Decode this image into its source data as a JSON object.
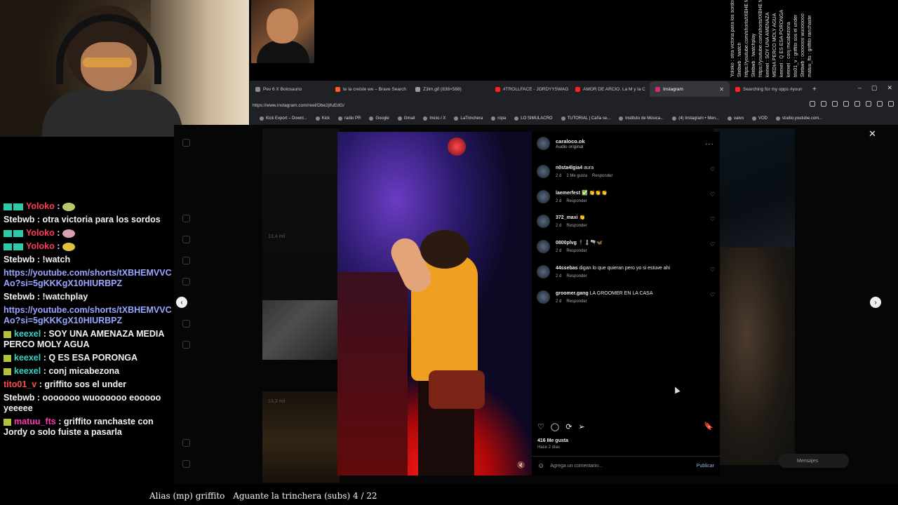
{
  "browser": {
    "tabs": [
      {
        "label": "Pev 6 X Bolosaurio",
        "color": "#8a8a8a",
        "active": false
      },
      {
        "label": "te la creiste we – Brave Search",
        "color": "#ff5a2a",
        "active": false
      },
      {
        "label": "Z3im.gif (838×588)",
        "color": "#9a9a9a",
        "active": false
      },
      {
        "label": "#TROLLFACE - JORDYYSWAG",
        "color": "#ff2020",
        "active": false
      },
      {
        "label": "AMOR DE ARCIO. La M y la C",
        "color": "#ff2020",
        "active": false
      },
      {
        "label": "Instagram",
        "color": "#d62976",
        "active": true
      },
      {
        "label": "Searching for my opps #youn",
        "color": "#ff2020",
        "active": false
      }
    ],
    "new_tab": "+",
    "url": "https://www.instagram.com/reel/Dbe2jifuEdG/",
    "bookmarks": [
      "Kick Export – Downl...",
      "Kick",
      "radio PR",
      "Google",
      "Gmail",
      "Inicio / X",
      "LaTrinchera",
      "ropa",
      "LO SIMULACRO",
      "TUTORIAL | Caña se...",
      "Instituto de Música...",
      "(4) Instagram • Men...",
      "vaivo",
      "VOD",
      "studio.youtube.com..."
    ]
  },
  "instagram": {
    "views": [
      "13,4 mil",
      "13,3 mil"
    ],
    "post": {
      "username": "caraloco.ok",
      "audio": "Audio original",
      "more": "···",
      "comments": [
        {
          "user": "n0sta4lgia4",
          "text": "aura",
          "time": "2 d",
          "likes": "2 Me gusta",
          "reply": "Responder"
        },
        {
          "user": "laemerfest",
          "text": "✅ 👏👏👏",
          "time": "2 d",
          "likes": "",
          "reply": "Responder"
        },
        {
          "user": "372_maxi",
          "text": "👏",
          "time": "2 d",
          "likes": "",
          "reply": "Responder"
        },
        {
          "user": "0800plvg",
          "text": "🕴️🌡️🫗🦋",
          "time": "2 d",
          "likes": "",
          "reply": "Responder"
        },
        {
          "user": "44ssebas",
          "text": "digan lo que quieran pero yo si estuve ahi",
          "time": "2 d",
          "likes": "",
          "reply": "Responder"
        },
        {
          "user": "groomer.gang",
          "text": "LA GROOMER EN LA CASA",
          "time": "2 d",
          "likes": "",
          "reply": "Responder"
        }
      ],
      "like_count": "416 Me gusta",
      "posted_ago": "Hace 2 días",
      "comment_placeholder": "Agrega un comentario...",
      "publish_label": "Publicar"
    },
    "close": "✕",
    "prev": "‹",
    "next": "›",
    "messages": "Mensajes"
  },
  "chat": [
    {
      "user": "Yoloko",
      "color": "#ff3b5c",
      "badge": "mod",
      "text": "",
      "emote_color": "#b7c96a"
    },
    {
      "user": "",
      "color": "#f2f2f2",
      "badge": "",
      "text": "Stebwb : otra victoria para los sordos"
    },
    {
      "user": "Yoloko",
      "color": "#ff3b5c",
      "badge": "mod",
      "text": "",
      "emote_color": "#d9a0b0"
    },
    {
      "user": "Yoloko",
      "color": "#ff3b5c",
      "badge": "mod",
      "text": "",
      "emote_color": "#e0c040"
    },
    {
      "user": "",
      "color": "#f2f2f2",
      "badge": "",
      "text": "Stebwb : !watch"
    },
    {
      "user": "",
      "color": "#9aa5ff",
      "badge": "",
      "text": "https://youtube.com/shorts/tXBHEMVVCAo?si=5gKKKgX10HIURBPZ",
      "link": true
    },
    {
      "user": "",
      "color": "#f2f2f2",
      "badge": "",
      "text": "Stebwb : !watchplay"
    },
    {
      "user": "",
      "color": "#9aa5ff",
      "badge": "",
      "text": "https://youtube.com/shorts/tXBHEMVVCAo?si=5gKKKgX10HIURBPZ",
      "link": true
    },
    {
      "user": "keexel",
      "color": "#36d2c6",
      "badge": "sub",
      "text": " : SOY UNA AMENAZA MEDIA PERCO MOLY AGUA"
    },
    {
      "user": "keexel",
      "color": "#36d2c6",
      "badge": "sub",
      "text": " : Q ES ESA PORONGA"
    },
    {
      "user": "keexel",
      "color": "#36d2c6",
      "badge": "sub",
      "text": " : conj micabezona"
    },
    {
      "user": "tito01_v",
      "color": "#ff4a4a",
      "badge": "",
      "text": " : griffito sos el under"
    },
    {
      "user": "",
      "color": "#f2f2f2",
      "badge": "",
      "text": "Stebwb : ooooooo wuoooooo eooooo yeeeee"
    },
    {
      "user": "matuu_fts",
      "color": "#ff3bb0",
      "badge": "sub",
      "text": " : griffito ranchaste con Jordy o solo fuiste a pasarla"
    }
  ],
  "vertical_chat": [
    "Yoloko : otra victoria para los sordos",
    "Stebwb : !watch",
    "https://youtube.com/shorts/tXBHE MVVCAo?si=5gKKKgX10HIURBPZ",
    "Stebwb : !watchplay",
    "https://youtube.com/shorts/tXBHE MVVCAo?si=5gKKKgX10HIURBPZ",
    "keexel : SOY UNA AMENAZA",
    "MEDIA PERCO MOLY AGUA",
    "keexel : Q ES ESA PORONGA",
    "keexel : conj micabezona",
    "tito01_v : griffito sos el under",
    "Stebwb : ooooooo wuoooooo",
    "matuu_fts : griffito ranchaste"
  ],
  "ticker": {
    "alias": "Alias (mp) griffito",
    "goal": "Aguante la trinchera (subs) 4 / 22"
  }
}
